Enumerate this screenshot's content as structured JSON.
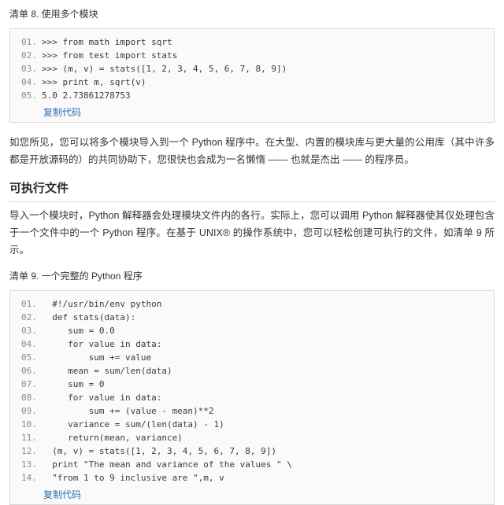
{
  "listing8": {
    "caption": "清单 8. 使用多个模块",
    "lines": [
      {
        "no": "01.",
        "code": ">>> from math import sqrt"
      },
      {
        "no": "02.",
        "code": ">>> from test import stats"
      },
      {
        "no": "03.",
        "code": ">>> (m, v) = stats([1, 2, 3, 4, 5, 6, 7, 8, 9])"
      },
      {
        "no": "04.",
        "code": ">>> print m, sqrt(v)"
      },
      {
        "no": "05.",
        "code": "5.0 2.73861278753"
      }
    ],
    "copy_label": "复制代码"
  },
  "paragraph1": "如您所见，您可以将多个模块导入到一个 Python 程序中。在大型、内置的模块库与更大量的公用库（其中许多都是开放源码的）的共同协助下，您很快也会成为一名懒惰 —— 也就是杰出 —— 的程序员。",
  "section": {
    "title": "可执行文件"
  },
  "paragraph2": "导入一个模块时，Python 解释器会处理模块文件内的各行。实际上，您可以调用 Python 解释器使其仅处理包含于一个文件中的一个 Python 程序。在基于 UNIX® 的操作系统中，您可以轻松创建可执行的文件，如清单 9 所示。",
  "listing9": {
    "caption": "清单 9. 一个完整的 Python 程序",
    "lines": [
      {
        "no": "01.",
        "code": "  #!/usr/bin/env python"
      },
      {
        "no": "02.",
        "code": "  def stats(data):"
      },
      {
        "no": "03.",
        "code": "     sum = 0.0"
      },
      {
        "no": "04.",
        "code": "     for value in data:"
      },
      {
        "no": "05.",
        "code": "         sum += value"
      },
      {
        "no": "06.",
        "code": "     mean = sum/len(data)"
      },
      {
        "no": "07.",
        "code": "     sum = 0"
      },
      {
        "no": "08.",
        "code": "     for value in data:"
      },
      {
        "no": "09.",
        "code": "         sum += (value - mean)**2"
      },
      {
        "no": "10.",
        "code": "     variance = sum/(len(data) - 1)"
      },
      {
        "no": "11.",
        "code": "     return(mean, variance)"
      },
      {
        "no": "12.",
        "code": "  (m, v) = stats([1, 2, 3, 4, 5, 6, 7, 8, 9])"
      },
      {
        "no": "13.",
        "code": "  print \"The mean and variance of the values \" \\"
      },
      {
        "no": "14.",
        "code": "  \"from 1 to 9 inclusive are \",m, v"
      }
    ],
    "copy_label": "复制代码"
  }
}
